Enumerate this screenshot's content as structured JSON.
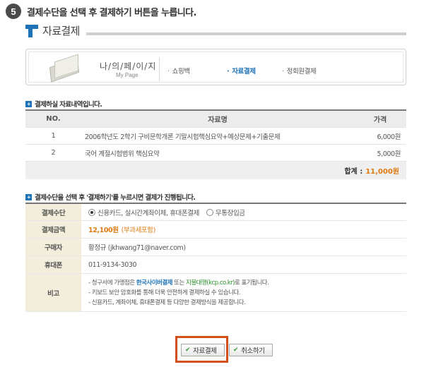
{
  "step": {
    "number": "5",
    "instruction": "결제수단을 선택 후 결제하기 버튼을 누릅니다."
  },
  "section": {
    "title": "자료결제"
  },
  "mypage": {
    "title": "나/의/페/이/지",
    "subtitle": "My Page",
    "links": [
      {
        "label": "쇼핑백",
        "active": false
      },
      {
        "label": "자료결제",
        "active": true
      },
      {
        "label": "정회원결제",
        "active": false
      }
    ],
    "icon": "book-icon"
  },
  "items_section": {
    "heading": "결제하실 자료내역입니다.",
    "columns": {
      "no": "NO.",
      "name": "자료명",
      "price": "가격"
    },
    "rows": [
      {
        "no": "1",
        "name": "2006학년도 2학기 구비문학개론 기말시험핵심요약+예상문제+기출문제",
        "price": "6,000원"
      },
      {
        "no": "2",
        "name": "국어 계절시험범위 핵심요약",
        "price": "5,000원"
      }
    ],
    "total_label": "합계 :",
    "total_amount": "11,000원"
  },
  "payment_section": {
    "heading": "결제수단을 선택 후 '결제하기'를 누르시면 결제가 진행됩니다.",
    "method_label": "결제수단",
    "method_options": [
      {
        "label": "신용카드, 실시간계좌이체, 휴대폰결제",
        "selected": true
      },
      {
        "label": "무통장입금",
        "selected": false
      }
    ],
    "amount_label": "결제금액",
    "amount_value": "12,100원",
    "amount_note": "(부과세포함)",
    "buyer_label": "구매자",
    "buyer_value": "황정규 (jkhwang71@naver.com)",
    "phone_label": "휴대폰",
    "phone_value": "011-9134-3030",
    "notes_label": "비고",
    "notes": {
      "line1_prefix": "- 청구서에 가맹점은 ",
      "line1_highlight1": "한국사이버결제",
      "line1_mid": " 또는 ",
      "line1_highlight2": "지불대행(kcp.co.kr)",
      "line1_suffix": "로 표기됩니다.",
      "line2": "- 키보드 보안 암호화를 통해 더욱 안전하게 결제하실 수 있습니다.",
      "line3": "- 신용카드, 계좌이체, 휴대폰결제 등 다양한 결제방식을 제공합니다."
    }
  },
  "buttons": {
    "pay": "자료결제",
    "cancel": "취소하기"
  },
  "colors": {
    "accent_blue": "#1e73b8",
    "accent_orange": "#e07a10",
    "highlight_border": "#d2501e",
    "label_bg": "#f3eedb"
  }
}
